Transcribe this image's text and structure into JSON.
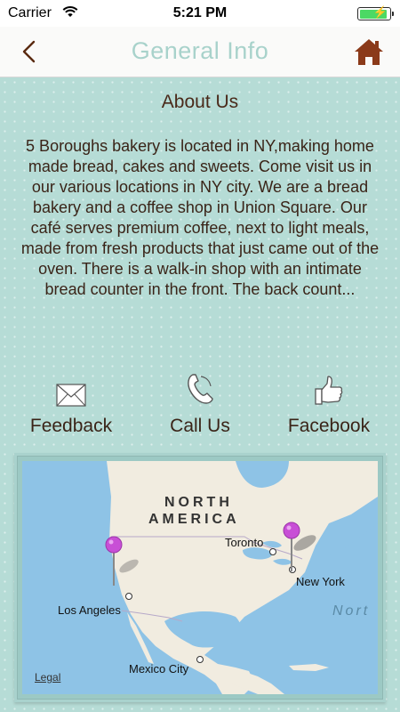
{
  "status_bar": {
    "carrier": "Carrier",
    "time": "5:21 PM",
    "battery_color": "#4cd964"
  },
  "nav": {
    "title": "General Info",
    "back_icon": "chevron-left-icon",
    "home_icon": "home-icon",
    "title_color": "#a8d2cb",
    "home_color": "#8b3a1a"
  },
  "about": {
    "heading": "About Us",
    "text": "5 Boroughs bakery is located in NY,making home made bread, cakes and sweets. Come visit us in our various locations in NY city. We are a bread bakery and a coffee shop in Union Square. Our café serves premium coffee, next to light meals, made from fresh products that just came out of the oven. There is a walk-in shop with an intimate bread counter in the front. The back count..."
  },
  "actions": [
    {
      "label": "Feedback",
      "icon": "envelope-icon"
    },
    {
      "label": "Call Us",
      "icon": "phone-icon"
    },
    {
      "label": "Facebook",
      "icon": "thumbs-up-icon"
    }
  ],
  "map": {
    "region_line1": "NORTH",
    "region_line2": "AMERICA",
    "ocean": "Nort",
    "cities": [
      "Toronto",
      "New York",
      "Los Angeles",
      "Mexico City"
    ],
    "legal": "Legal",
    "pin_color": "#c84fd6"
  },
  "colors": {
    "background": "#b6dcd6",
    "text_brown": "#3a2418"
  }
}
